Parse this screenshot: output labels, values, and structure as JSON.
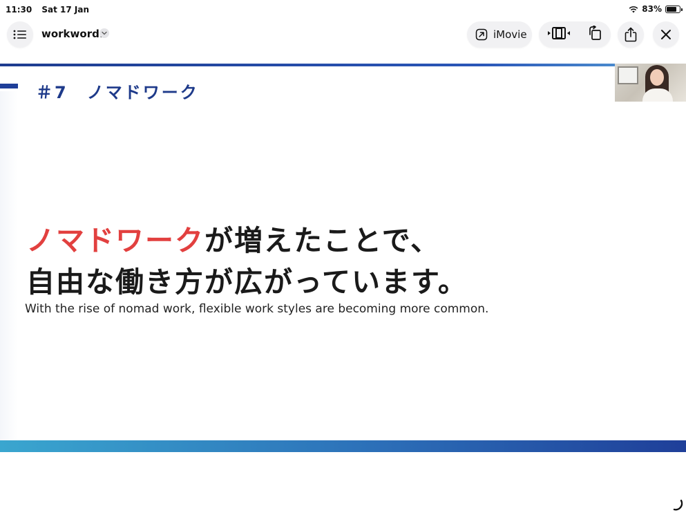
{
  "status_bar": {
    "time": "11:30",
    "date": "Sat 17 Jan",
    "battery_text": "83%",
    "battery_level": 0.83,
    "wifi_icon": "wifi-icon"
  },
  "toolbar": {
    "sidebar_icon": "list-icon",
    "document_title": "workword1",
    "title_menu_icon": "chevron-down-icon",
    "imovie_label": "iMovie",
    "imovie_icon": "open-external-icon",
    "trim_icon": "film-trim-icon",
    "rotate_icon": "rotate-icon",
    "share_icon": "share-icon",
    "close_icon": "close-icon"
  },
  "slide": {
    "heading": "＃7　ノマドワーク",
    "line1_accent": "ノマドワーク",
    "line1_rest": "が増えたことで、",
    "line2": "自由な働き方が広がっています。",
    "subtitle": "With the rise of nomad work, flexible work styles are becoming more common.",
    "colors": {
      "accent_red": "#e2403f",
      "heading_blue": "#1e3a8a",
      "rule_blue": "#1f3f99"
    }
  }
}
